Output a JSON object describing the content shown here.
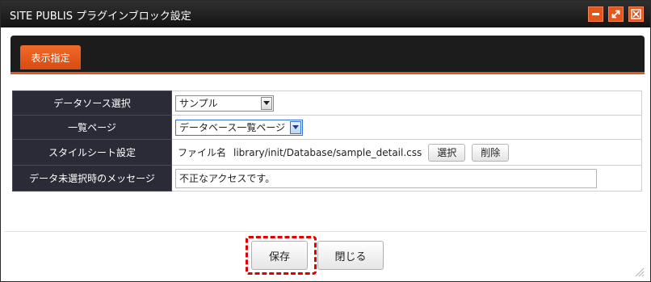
{
  "window": {
    "title": "SITE PUBLIS プラグインブロック設定",
    "accent_color": "#e5561a",
    "controls": [
      "minimize-icon",
      "maximize-icon",
      "close-icon"
    ]
  },
  "tabs": [
    {
      "label": "表示指定",
      "active": true
    }
  ],
  "form": {
    "rows": [
      {
        "label": "データソース選択",
        "control": "select",
        "value": "サンプル"
      },
      {
        "label": "一覧ページ",
        "control": "select",
        "value": "データベース一覧ページ"
      },
      {
        "label": "スタイルシート設定",
        "control": "file",
        "file_label": "ファイル名",
        "value": "library/init/Database/sample_detail.css",
        "buttons": [
          "選択",
          "削除"
        ]
      },
      {
        "label": "データ未選択時のメッセージ",
        "control": "text",
        "value": "不正なアクセスです。"
      }
    ]
  },
  "footer": {
    "save_label": "保存",
    "close_label": "閉じる",
    "highlight_color": "#e00000"
  }
}
